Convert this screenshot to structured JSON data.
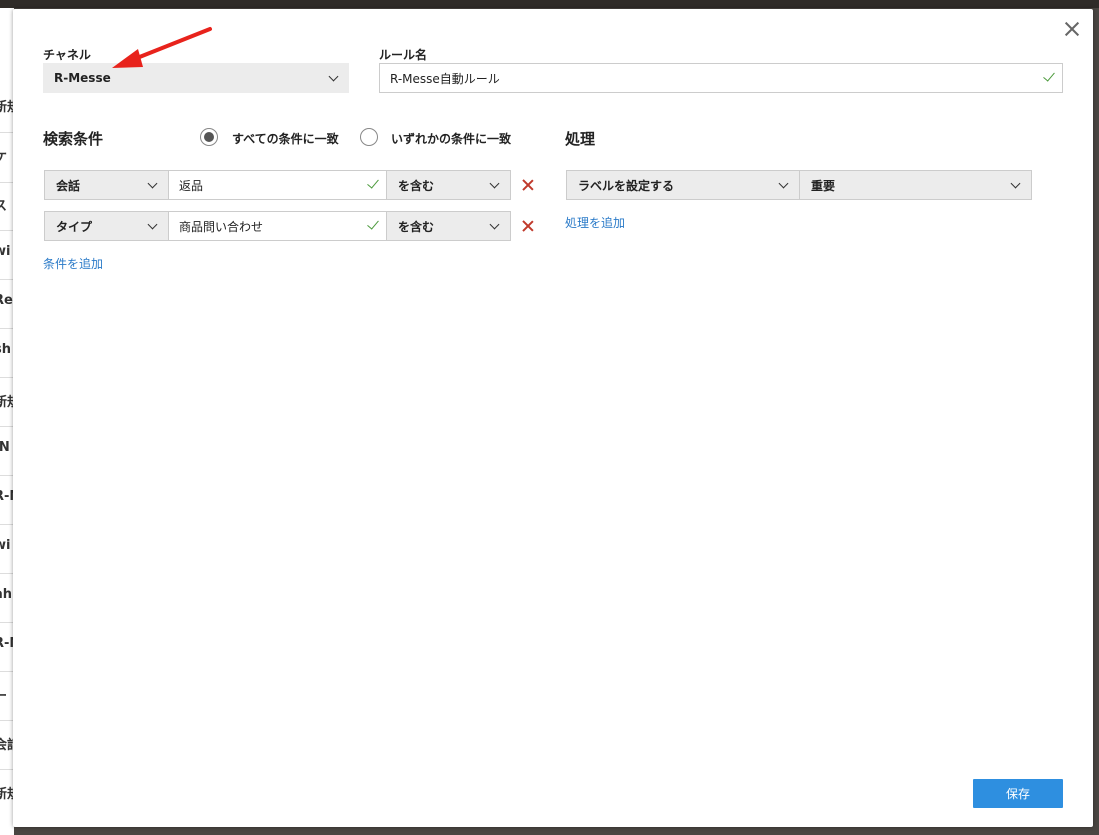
{
  "background": {
    "side_items": [
      "新規",
      "ケ",
      "ス",
      "wi",
      "Re",
      "sh",
      "新規",
      "IN",
      "R-M",
      "wi",
      "ah",
      "R-M",
      "ー",
      "会話",
      "新規"
    ]
  },
  "dialog": {
    "channel_label": "チャネル",
    "channel_value": "R-Messe",
    "rule_name_label": "ルール名",
    "rule_name_value": "R-Messe自動ルール",
    "search_title": "検索条件",
    "match_all_label": "すべての条件に一致",
    "match_any_label": "いずれかの条件に一致",
    "match_mode": "all",
    "conditions": [
      {
        "field": "会話",
        "value": "返品",
        "operator": "を含む"
      },
      {
        "field": "タイプ",
        "value": "商品問い合わせ",
        "operator": "を含む"
      }
    ],
    "add_condition_label": "条件を追加",
    "actions_title": "処理",
    "actions": [
      {
        "action": "ラベルを設定する",
        "value": "重要"
      }
    ],
    "add_action_label": "処理を追加",
    "save_label": "保存"
  },
  "colors": {
    "primary_button": "#2e8fe0",
    "link": "#2a7ac8",
    "delete_x": "#c0392b",
    "valid_check": "#4c9a3c",
    "annotation_arrow": "#e8231c"
  },
  "icons": {
    "close": "close-icon",
    "dropdown": "chevron-down-icon",
    "valid": "check-icon",
    "delete": "delete-x-icon"
  }
}
